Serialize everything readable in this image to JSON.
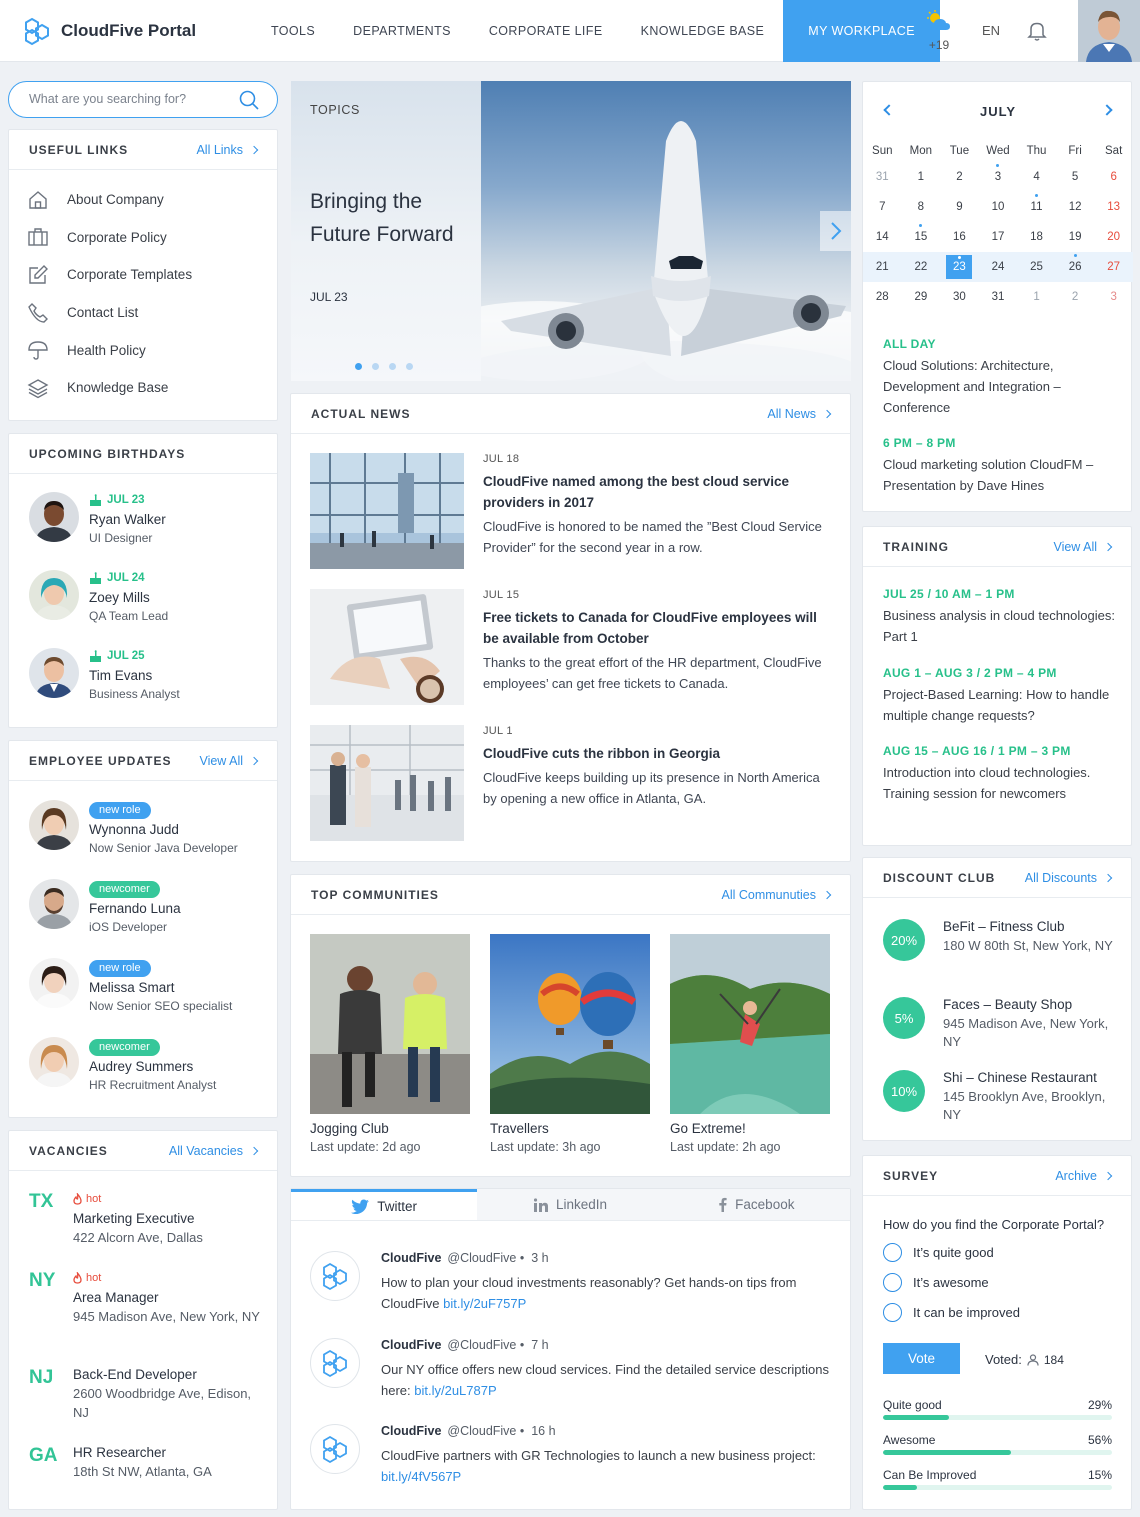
{
  "header": {
    "brand": "CloudFive Portal",
    "nav": [
      {
        "label": "TOOLS"
      },
      {
        "label": "DEPARTMENTS"
      },
      {
        "label": "CORPORATE LIFE"
      },
      {
        "label": "KNOWLEDGE BASE"
      },
      {
        "label": "MY WORKPLACE"
      }
    ],
    "weather_temp": "+19",
    "lang": "EN"
  },
  "search": {
    "placeholder": "What are you searching for?"
  },
  "useful_links": {
    "title": "USEFUL LINKS",
    "link": "All Links",
    "items": [
      {
        "label": "About Company",
        "icon": "home-icon"
      },
      {
        "label": "Corporate Policy",
        "icon": "briefcase-icon"
      },
      {
        "label": "Corporate Templates",
        "icon": "edit-icon"
      },
      {
        "label": "Contact List",
        "icon": "phone-icon"
      },
      {
        "label": "Health Policy",
        "icon": "umbrella-icon"
      },
      {
        "label": "Knowledge Base",
        "icon": "layers-icon"
      }
    ]
  },
  "birthdays": {
    "title": "UPCOMING BIRTHDAYS",
    "items": [
      {
        "date": "JUL 23",
        "name": "Ryan Walker",
        "role": "UI Designer"
      },
      {
        "date": "JUL 24",
        "name": "Zoey Mills",
        "role": "QA Team Lead"
      },
      {
        "date": "JUL 25",
        "name": "Tim Evans",
        "role": "Business Analyst"
      }
    ]
  },
  "employee_updates": {
    "title": "EMPLOYEE UPDATES",
    "link": "View All",
    "items": [
      {
        "badge": "new role",
        "name": "Wynonna Judd",
        "role": "Now Senior Java Developer"
      },
      {
        "badge": "newcomer",
        "name": "Fernando Luna",
        "role": "iOS Developer"
      },
      {
        "badge": "new role",
        "name": "Melissa Smart",
        "role": "Now Senior SEO specialist"
      },
      {
        "badge": "newcomer",
        "name": "Audrey Summers",
        "role": "HR Recruitment Analyst"
      }
    ]
  },
  "vacancies": {
    "title": "VACANCIES",
    "link": "All Vacancies",
    "items": [
      {
        "code": "TX",
        "hot": "hot",
        "title": "Marketing Executive",
        "address": "422 Alcorn Ave, Dallas"
      },
      {
        "code": "NY",
        "hot": "hot",
        "title": "Area Manager",
        "address": "945 Madison Ave, New York, NY"
      },
      {
        "code": "NJ",
        "hot": "",
        "title": "Back-End Developer",
        "address": "2600 Woodbridge Ave, Edison, NJ"
      },
      {
        "code": "GA",
        "hot": "",
        "title": "HR Researcher",
        "address": "18th St NW, Atlanta, GA"
      }
    ]
  },
  "hero": {
    "topics": "TOPICS",
    "title": "Bringing the Future Forward",
    "date": "JUL 23"
  },
  "news": {
    "title": "ACTUAL NEWS",
    "link": "All News",
    "items": [
      {
        "date": "JUL 18",
        "title": "CloudFive named among the best cloud service providers in 2017",
        "text": "CloudFive is honored to be named the ”Best Cloud Service Provider” for the second year in a row."
      },
      {
        "date": "JUL 15",
        "title": "Free tickets to Canada for CloudFive employees will be available from October",
        "text": "Thanks to the great effort of the HR department, CloudFive employees’ can get free tickets to Canada."
      },
      {
        "date": "JUL 1",
        "title": "CloudFive cuts the ribbon in Georgia",
        "text": "CloudFive keeps building up its presence in North America by opening a new office in Atlanta, GA."
      }
    ]
  },
  "communities": {
    "title": "TOP COMMUNITIES",
    "link": "All Communuties",
    "items": [
      {
        "name": "Jogging Club",
        "updated": "Last update: 2d ago"
      },
      {
        "name": "Travellers",
        "updated": "Last update: 3h ago"
      },
      {
        "name": "Go Extreme!",
        "updated": "Last update: 2h ago"
      }
    ]
  },
  "social": {
    "tabs": [
      {
        "label": "Twitter"
      },
      {
        "label": "LinkedIn"
      },
      {
        "label": "Facebook"
      }
    ],
    "tweets": [
      {
        "name": "CloudFive",
        "handle": "@CloudFive",
        "time": "3 h",
        "text": "How to plan your cloud investments reasonably? Get hands-on tips from CloudFive ",
        "link": "bit.ly/2uF757P"
      },
      {
        "name": "CloudFive",
        "handle": "@CloudFive",
        "time": "7 h",
        "text": "Our NY office offers new cloud services. Find the detailed service descriptions here: ",
        "link": "bit.ly/2uL787P"
      },
      {
        "name": "CloudFive",
        "handle": "@CloudFive",
        "time": "16 h",
        "text": "CloudFive partners with GR Technologies to launch a new business project: ",
        "link": "bit.ly/4fV567P"
      }
    ]
  },
  "calendar": {
    "month": "JULY",
    "weekdays": [
      "Sun",
      "Mon",
      "Tue",
      "Wed",
      "Thu",
      "Fri",
      "Sat"
    ],
    "weeks": [
      [
        {
          "d": "31",
          "m": true
        },
        {
          "d": "1"
        },
        {
          "d": "2"
        },
        {
          "d": "3",
          "dot": true
        },
        {
          "d": "4"
        },
        {
          "d": "5"
        },
        {
          "d": "6"
        }
      ],
      [
        {
          "d": "7"
        },
        {
          "d": "8"
        },
        {
          "d": "9"
        },
        {
          "d": "10"
        },
        {
          "d": "11",
          "dot": true
        },
        {
          "d": "12"
        },
        {
          "d": "13"
        }
      ],
      [
        {
          "d": "14"
        },
        {
          "d": "15",
          "dot": true
        },
        {
          "d": "16"
        },
        {
          "d": "17"
        },
        {
          "d": "18"
        },
        {
          "d": "19"
        },
        {
          "d": "20"
        }
      ],
      [
        {
          "d": "21"
        },
        {
          "d": "22"
        },
        {
          "d": "23",
          "today": true,
          "dot": true
        },
        {
          "d": "24"
        },
        {
          "d": "25"
        },
        {
          "d": "26",
          "dot": true
        },
        {
          "d": "27"
        }
      ],
      [
        {
          "d": "28"
        },
        {
          "d": "29"
        },
        {
          "d": "30"
        },
        {
          "d": "31"
        },
        {
          "d": "1",
          "m": true
        },
        {
          "d": "2",
          "m": true
        },
        {
          "d": "3",
          "m": true
        }
      ]
    ],
    "events": [
      {
        "time": "ALL DAY",
        "title": "Cloud Solutions: Architecture, Development and Integration – Conference"
      },
      {
        "time": "6 PM – 8 PM",
        "title": "Cloud marketing solution CloudFM – Presentation by Dave Hines"
      }
    ]
  },
  "training": {
    "title": "TRAINING",
    "link": "View All",
    "items": [
      {
        "time": "JUL 25 / 10 AM – 1 PM",
        "title": "Business analysis in cloud technologies: Part 1"
      },
      {
        "time": "AUG 1 – AUG 3 / 2 PM – 4 PM",
        "title": "Project-Based Learning: How to handle multiple change requests?"
      },
      {
        "time": "AUG 15 – AUG 16 / 1 PM – 3 PM",
        "title": "Introduction into cloud technologies. Training session for newcomers"
      }
    ]
  },
  "discounts": {
    "title": "DISCOUNT CLUB",
    "link": "All Discounts",
    "items": [
      {
        "pct": "20%",
        "name": "BeFit – Fitness Club",
        "address": "180 W 80th St, New York, NY"
      },
      {
        "pct": "5%",
        "name": "Faces – Beauty Shop",
        "address": "945 Madison Ave, New York, NY"
      },
      {
        "pct": "10%",
        "name": "Shi – Chinese Restaurant",
        "address": "145 Brooklyn Ave, Brooklyn, NY"
      }
    ]
  },
  "survey": {
    "title": "SURVEY",
    "link": "Archive",
    "question": "How do you find the Corporate Portal?",
    "options": [
      {
        "label": "It’s quite good"
      },
      {
        "label": "It’s awesome"
      },
      {
        "label": "It can be improved"
      }
    ],
    "vote_label": "Vote",
    "voted_label": "Voted:",
    "voted_count": "184",
    "results": [
      {
        "label": "Quite good",
        "pct": "29%",
        "value": 29
      },
      {
        "label": "Awesome",
        "pct": "56%",
        "value": 56
      },
      {
        "label": "Can Be Improved",
        "pct": "15%",
        "value": 15
      }
    ]
  }
}
